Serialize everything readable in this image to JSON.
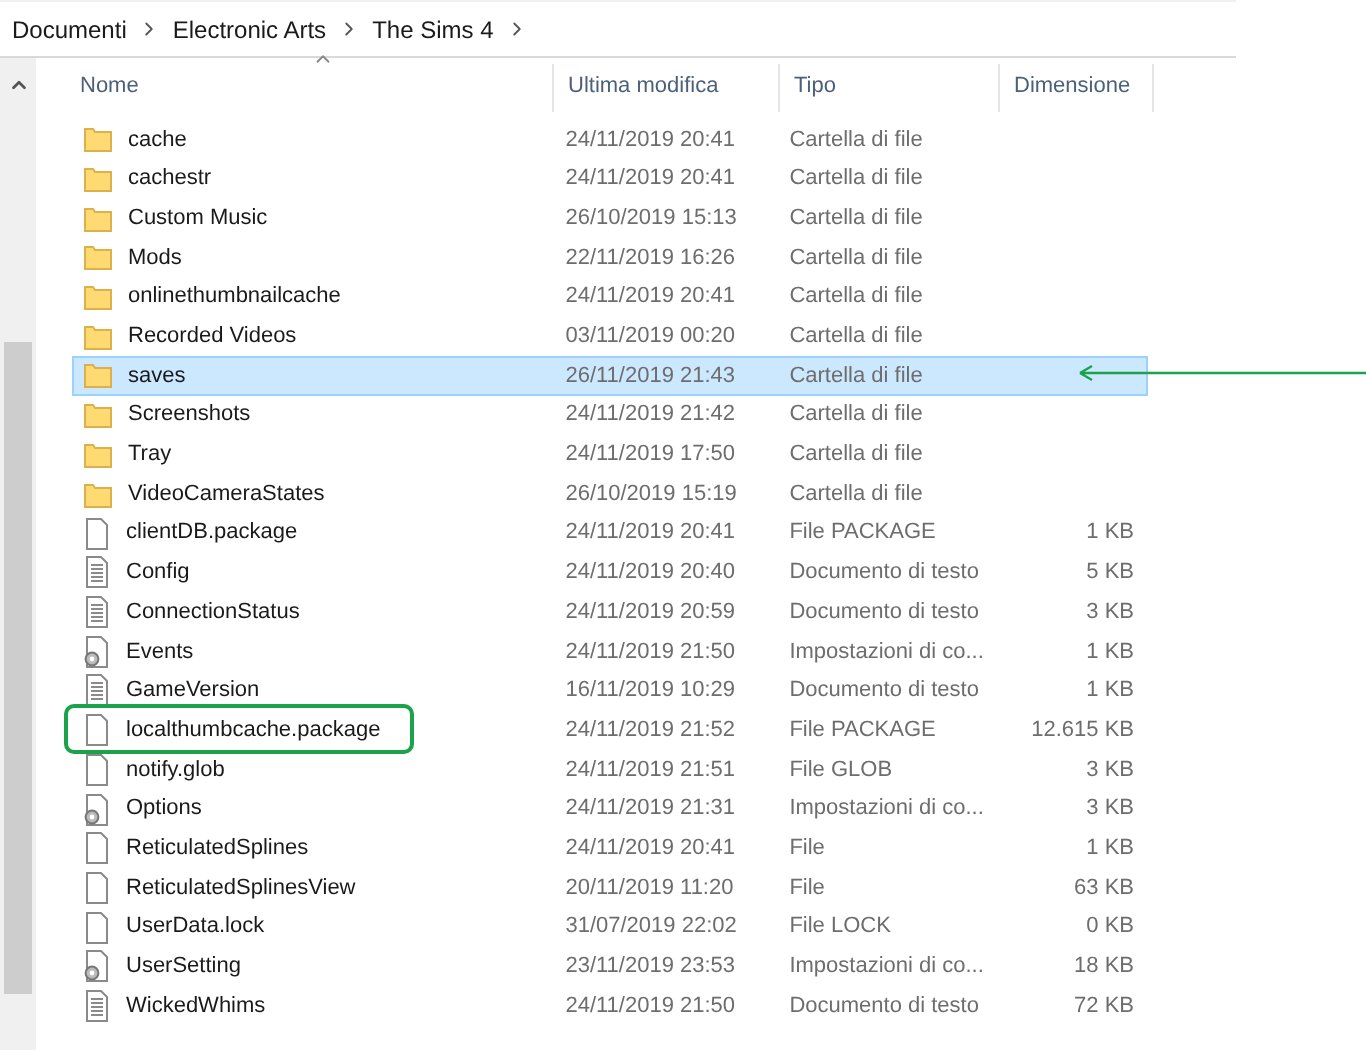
{
  "breadcrumb": [
    "Documenti",
    "Electronic Arts",
    "The Sims 4"
  ],
  "columns": [
    {
      "label": "Nome",
      "sorted": true
    },
    {
      "label": "Ultima modifica",
      "sorted": false
    },
    {
      "label": "Tipo",
      "sorted": false
    },
    {
      "label": "Dimensione",
      "sorted": false
    }
  ],
  "rows": [
    {
      "kind": "folder",
      "name": "cache",
      "modified": "24/11/2019 20:41",
      "type": "Cartella di file",
      "selected": false
    },
    {
      "kind": "folder",
      "name": "cachestr",
      "modified": "24/11/2019 20:41",
      "type": "Cartella di file",
      "selected": false
    },
    {
      "kind": "folder",
      "name": "Custom Music",
      "modified": "26/10/2019 15:13",
      "type": "Cartella di file",
      "selected": false
    },
    {
      "kind": "folder",
      "name": "Mods",
      "modified": "22/11/2019 16:26",
      "type": "Cartella di file",
      "selected": false
    },
    {
      "kind": "folder",
      "name": "onlinethumbnailcache",
      "modified": "24/11/2019 20:41",
      "type": "Cartella di file",
      "selected": false
    },
    {
      "kind": "folder",
      "name": "Recorded Videos",
      "modified": "03/11/2019 00:20",
      "type": "Cartella di file",
      "selected": false
    },
    {
      "kind": "folder",
      "name": "saves",
      "modified": "26/11/2019 21:43",
      "type": "Cartella di file",
      "selected": true,
      "arrow": true
    },
    {
      "kind": "folder",
      "name": "Screenshots",
      "modified": "24/11/2019 21:42",
      "type": "Cartella di file",
      "selected": false
    },
    {
      "kind": "folder",
      "name": "Tray",
      "modified": "24/11/2019 17:50",
      "type": "Cartella di file",
      "selected": false
    },
    {
      "kind": "folder",
      "name": "VideoCameraStates",
      "modified": "26/10/2019 15:19",
      "type": "Cartella di file",
      "selected": false
    },
    {
      "kind": "file",
      "name": "clientDB.package",
      "modified": "24/11/2019 20:41",
      "type": "File PACKAGE",
      "size": "1 KB",
      "selected": false
    },
    {
      "kind": "text",
      "name": "Config",
      "modified": "24/11/2019 20:40",
      "type": "Documento di testo",
      "size": "5 KB",
      "selected": false
    },
    {
      "kind": "text",
      "name": "ConnectionStatus",
      "modified": "24/11/2019 20:59",
      "type": "Documento di testo",
      "size": "3 KB",
      "selected": false
    },
    {
      "kind": "settings",
      "name": "Events",
      "modified": "24/11/2019 21:50",
      "type": "Impostazioni di co...",
      "size": "1 KB",
      "selected": false
    },
    {
      "kind": "text",
      "name": "GameVersion",
      "modified": "16/11/2019 10:29",
      "type": "Documento di testo",
      "size": "1 KB",
      "selected": false
    },
    {
      "kind": "file",
      "name": "localthumbcache.package",
      "modified": "24/11/2019 21:52",
      "type": "File PACKAGE",
      "size": "12.615 KB",
      "selected": false,
      "boxed": true
    },
    {
      "kind": "file",
      "name": "notify.glob",
      "modified": "24/11/2019 21:51",
      "type": "File GLOB",
      "size": "3 KB",
      "selected": false
    },
    {
      "kind": "settings",
      "name": "Options",
      "modified": "24/11/2019 21:31",
      "type": "Impostazioni di co...",
      "size": "3 KB",
      "selected": false
    },
    {
      "kind": "file",
      "name": "ReticulatedSplines",
      "modified": "24/11/2019 20:41",
      "type": "File",
      "size": "1 KB",
      "selected": false
    },
    {
      "kind": "file",
      "name": "ReticulatedSplinesView",
      "modified": "20/11/2019 11:20",
      "type": "File",
      "size": "63 KB",
      "selected": false
    },
    {
      "kind": "file",
      "name": "UserData.lock",
      "modified": "31/07/2019 22:02",
      "type": "File LOCK",
      "size": "0 KB",
      "selected": false
    },
    {
      "kind": "settings",
      "name": "UserSetting",
      "modified": "23/11/2019 23:53",
      "type": "Impostazioni di co...",
      "size": "18 KB",
      "selected": false
    },
    {
      "kind": "text",
      "name": "WickedWhims",
      "modified": "24/11/2019 21:50",
      "type": "Documento di testo",
      "size": "72 KB",
      "selected": false
    }
  ]
}
